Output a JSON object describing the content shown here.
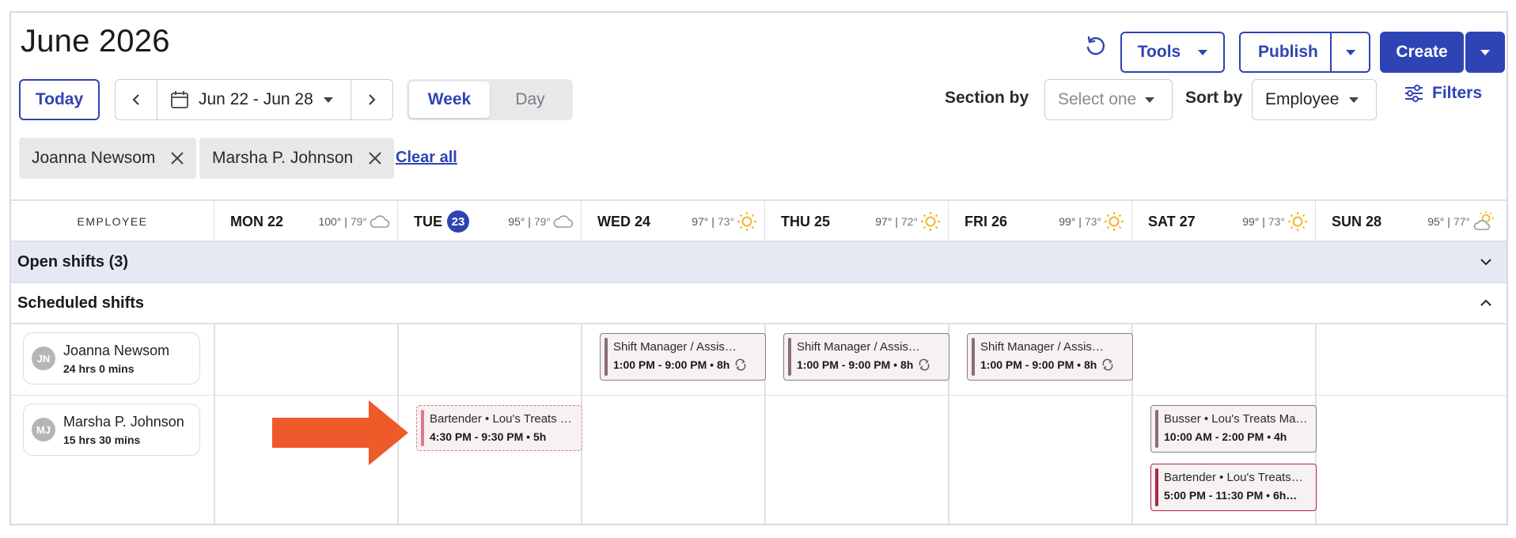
{
  "header": {
    "title": "June 2026",
    "tools_label": "Tools",
    "publish_label": "Publish",
    "create_label": "Create"
  },
  "toolbar": {
    "today_label": "Today",
    "date_range": "Jun 22 - Jun 28",
    "views": [
      "Week",
      "Day"
    ],
    "active_view": "Week",
    "section_by_label": "Section by",
    "section_by_value": "Select one",
    "sort_by_label": "Sort by",
    "sort_by_value": "Employee",
    "filters_label": "Filters"
  },
  "filter_chips": [
    "Joanna Newsom",
    "Marsha P. Johnson"
  ],
  "clear_all_label": "Clear all",
  "schedule": {
    "employee_col_label": "EMPLOYEE",
    "days": [
      {
        "label": "MON 22",
        "hi": "100°",
        "lo": "79°",
        "weather": "cloud-icon"
      },
      {
        "label": "TUE",
        "num": "23",
        "hi": "95°",
        "lo": "79°",
        "weather": "cloud-icon"
      },
      {
        "label": "WED 24",
        "hi": "97°",
        "lo": "73°",
        "weather": "sun-icon"
      },
      {
        "label": "THU 25",
        "hi": "97°",
        "lo": "72°",
        "weather": "sun-icon"
      },
      {
        "label": "FRI 26",
        "hi": "99°",
        "lo": "73°",
        "weather": "sun-icon"
      },
      {
        "label": "SAT 27",
        "hi": "99°",
        "lo": "73°",
        "weather": "sun-icon"
      },
      {
        "label": "SUN 28",
        "hi": "95°",
        "lo": "77°",
        "weather": "partly-sunny-icon"
      }
    ],
    "open_shifts_label": "Open shifts (3)",
    "scheduled_shifts_label": "Scheduled shifts",
    "employees": [
      {
        "initials": "JN",
        "name": "Joanna Newsom",
        "hours": "24 hrs 0 mins",
        "shifts": [
          {
            "role": "Shift Manager / Assis…",
            "time": "1:00 PM - 9:00 PM • 8h"
          },
          {
            "role": "Shift Manager / Assis…",
            "time": "1:00 PM - 9:00 PM • 8h"
          },
          {
            "role": "Shift Manager / Assis…",
            "time": "1:00 PM - 9:00 PM • 8h"
          }
        ]
      },
      {
        "initials": "MJ",
        "name": "Marsha P. Johnson",
        "hours": "15 hrs 30 mins",
        "shifts": [
          {
            "role": "Bartender • Lou's Treats …",
            "time": "4:30 PM - 9:30 PM • 5h"
          },
          {
            "role": "Busser • Lou's Treats Ma…",
            "time": "10:00 AM - 2:00 PM • 4h"
          },
          {
            "role": "Bartender • Lou's Treats…",
            "time": "5:00 PM - 11:30 PM • 6h…"
          }
        ]
      }
    ]
  },
  "colors": {
    "accent": "#2e44b4",
    "open_shift_band": "#e6e9f4",
    "arrow": "#ee5a2a",
    "sun": "#f4b52b"
  }
}
